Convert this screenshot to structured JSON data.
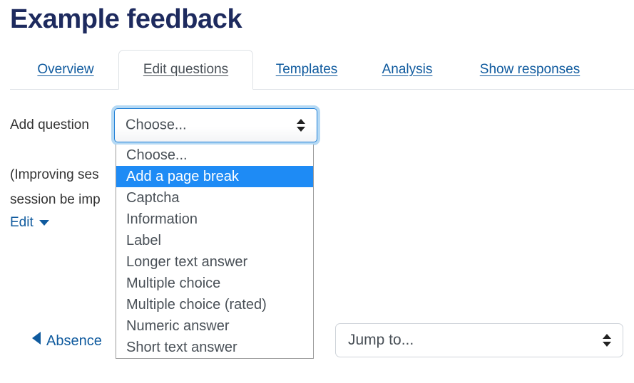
{
  "page": {
    "title": "Example feedback"
  },
  "tabs": [
    {
      "label": "Overview",
      "active": false
    },
    {
      "label": "Edit questions",
      "active": true
    },
    {
      "label": "Templates",
      "active": false
    },
    {
      "label": "Analysis",
      "active": false
    },
    {
      "label": "Show responses",
      "active": false
    }
  ],
  "add_question": {
    "label": "Add question",
    "select_value": "Choose...",
    "icon": "up-down-arrows-icon",
    "options": [
      "Choose...",
      "Add a page break",
      "Captcha",
      "Information",
      "Label",
      "Longer text answer",
      "Multiple choice",
      "Multiple choice (rated)",
      "Numeric answer",
      "Short text answer"
    ],
    "highlighted_option": "Add a page break"
  },
  "content": {
    "question_line_1": "(Improving ses",
    "question_line_2": "session be imp",
    "edit_label": "Edit",
    "edit_caret_icon": "caret-down-icon"
  },
  "footer": {
    "prev_label": "Absence",
    "prev_icon": "caret-left-icon",
    "jump_to_value": "Jump to...",
    "jump_to_icon": "up-down-arrows-icon"
  },
  "colors": {
    "title": "#1d2a5e",
    "link": "#0f5a9e",
    "highlight": "#1e8bf5",
    "focus_ring": "#78b9eb",
    "border": "#dee2e6"
  }
}
